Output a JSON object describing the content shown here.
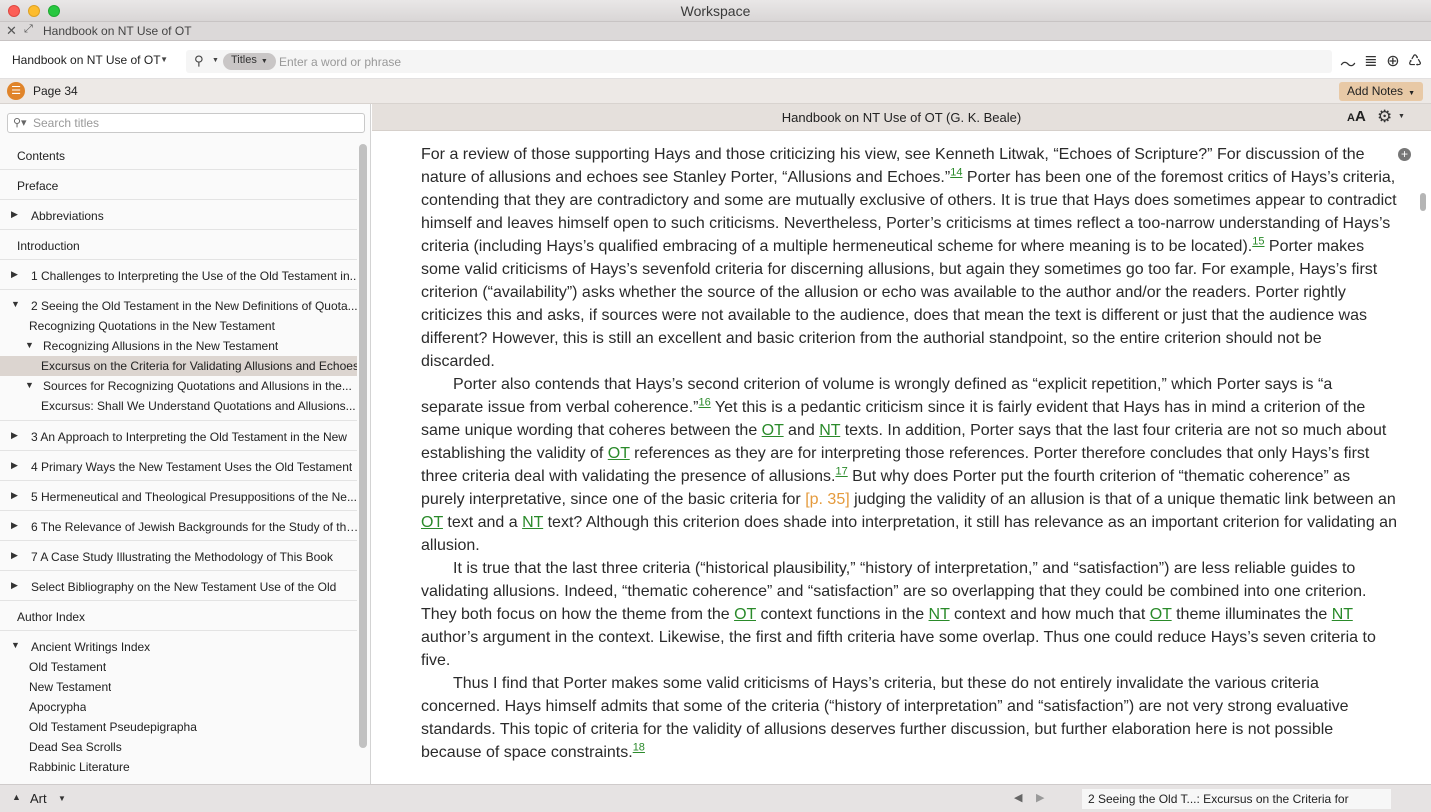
{
  "window": {
    "title": "Workspace"
  },
  "tab": {
    "label": "Handbook on NT Use of OT"
  },
  "toolbar": {
    "book_select": "Handbook on NT Use of OT",
    "search_scope": "Titles",
    "search_placeholder": "Enter a word or phrase"
  },
  "pagebar": {
    "page_label": "Page 34",
    "add_notes": "Add Notes"
  },
  "sidebar": {
    "search_placeholder": "Search titles",
    "items": [
      {
        "label": "Contents",
        "disclosure": ""
      },
      {
        "label": "Preface",
        "disclosure": ""
      },
      {
        "label": "Abbreviations",
        "disclosure": "▶"
      },
      {
        "label": "Introduction",
        "disclosure": ""
      },
      {
        "label": "1 Challenges to Interpreting the Use of the Old Testament in...",
        "disclosure": "▶"
      },
      {
        "label": "2 Seeing the Old Testament in the New Definitions of Quota...",
        "disclosure": "▼"
      }
    ],
    "chapter2_children": [
      {
        "label": "Recognizing Quotations in the New Testament"
      },
      {
        "label": "Recognizing Allusions in the New Testament",
        "disclosure": "▼"
      },
      {
        "label": "Excursus on the Criteria for Validating Allusions and Echoes"
      },
      {
        "label": "Sources for Recognizing Quotations and Allusions in the...",
        "disclosure": "▼"
      },
      {
        "label": "Excursus: Shall We Understand Quotations and Allusions..."
      }
    ],
    "items_after": [
      {
        "label": "3 An Approach to Interpreting the Old Testament in the New",
        "disclosure": "▶"
      },
      {
        "label": "4 Primary Ways the New Testament Uses the Old Testament",
        "disclosure": "▶"
      },
      {
        "label": "5 Hermeneutical and Theological Presuppositions of the Ne...",
        "disclosure": "▶"
      },
      {
        "label": "6 The Relevance of Jewish Backgrounds for the Study of the...",
        "disclosure": "▶"
      },
      {
        "label": "7 A Case Study Illustrating the Methodology of This Book",
        "disclosure": "▶"
      },
      {
        "label": "Select Bibliography on the New Testament Use of the Old",
        "disclosure": "▶"
      },
      {
        "label": "Author Index",
        "disclosure": ""
      },
      {
        "label": "Ancient Writings Index",
        "disclosure": "▼"
      }
    ],
    "index_children": [
      {
        "label": "Old Testament"
      },
      {
        "label": "New Testament"
      },
      {
        "label": "Apocrypha"
      },
      {
        "label": "Old Testament Pseudepigrapha"
      },
      {
        "label": "Dead Sea Scrolls"
      },
      {
        "label": "Rabbinic Literature"
      }
    ]
  },
  "bottombar": {
    "art_label": "Art",
    "location": "2 Seeing the Old T...: Excursus on the Criteria for"
  },
  "reader": {
    "title": "Handbook on NT Use of OT (G. K. Beale)",
    "aa_icon_text": "AA"
  },
  "colors": {
    "accent": "#e0842a",
    "link": "#2a8a2a",
    "page_ref": "#e49a3c",
    "selection": "#dcd5d0"
  }
}
